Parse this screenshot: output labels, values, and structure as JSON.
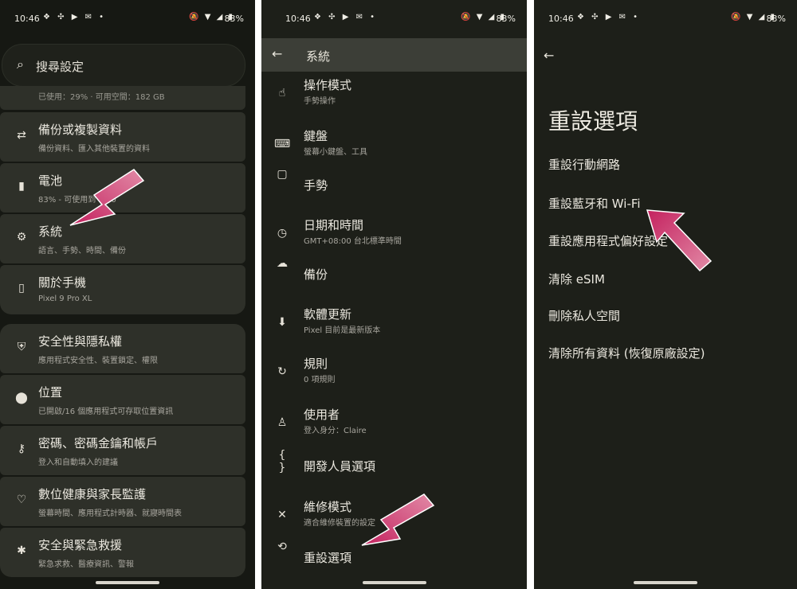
{
  "status": {
    "time": "10:46",
    "notif_icons": "❖ ✣ ▶ ✉ •",
    "right_icons": "🔕 ▼ ◢ ▮",
    "battery": "83%"
  },
  "panel1": {
    "search_placeholder": "搜尋設定",
    "partial_text": "已使用：29% · 可用空間：182 GB",
    "group1": [
      {
        "icon": "⇄",
        "icon_name": "backup-restore-icon",
        "title": "備份或複製資料",
        "subtitle": "備份資料、匯入其他裝置的資料"
      },
      {
        "icon": "▮",
        "icon_name": "battery-icon",
        "title": "電池",
        "subtitle": "83% - 可使用到 9:00"
      },
      {
        "icon": "⚙",
        "icon_name": "gear-icon",
        "title": "系統",
        "subtitle": "語言、手勢、時間、備份"
      },
      {
        "icon": "▯",
        "icon_name": "phone-icon",
        "title": "關於手機",
        "subtitle": "Pixel 9 Pro XL"
      }
    ],
    "group2": [
      {
        "icon": "⛨",
        "icon_name": "shield-icon",
        "title": "安全性與隱私權",
        "subtitle": "應用程式安全性、裝置鎖定、權限"
      },
      {
        "icon": "⬤",
        "icon_name": "location-pin-icon",
        "title": "位置",
        "subtitle": "已開啟/16 個應用程式可存取位置資訊"
      },
      {
        "icon": "⚷",
        "icon_name": "key-icon",
        "title": "密碼、密碼金鑰和帳戶",
        "subtitle": "登入和自動填入的建議"
      },
      {
        "icon": "♡",
        "icon_name": "wellbeing-icon",
        "title": "數位健康與家長監護",
        "subtitle": "螢幕時間、應用程式計時器、就寢時間表"
      },
      {
        "icon": "✱",
        "icon_name": "emergency-icon",
        "title": "安全與緊急救援",
        "subtitle": "緊急求救、醫療資訊、警報"
      }
    ]
  },
  "panel2": {
    "back_icon": "←",
    "title": "系統",
    "items": [
      {
        "icon": "☝",
        "icon_name": "gesture-hand-icon",
        "title": "操作模式",
        "subtitle": "手勢操作"
      },
      {
        "icon": "⌨",
        "icon_name": "keyboard-icon",
        "title": "鍵盤",
        "subtitle": "螢幕小鍵盤、工具"
      },
      {
        "icon": "▢",
        "icon_name": "gestures-icon",
        "title": "手勢",
        "subtitle": ""
      },
      {
        "icon": "◷",
        "icon_name": "clock-icon",
        "title": "日期和時間",
        "subtitle": "GMT+08:00 台北標準時間"
      },
      {
        "icon": "☁",
        "icon_name": "cloud-backup-icon",
        "title": "備份",
        "subtitle": ""
      },
      {
        "icon": "⬇",
        "icon_name": "system-update-icon",
        "title": "軟體更新",
        "subtitle": "Pixel 目前是最新版本"
      },
      {
        "icon": "↻",
        "icon_name": "rules-icon",
        "title": "規則",
        "subtitle": "0 項規則"
      },
      {
        "icon": "♙",
        "icon_name": "user-icon",
        "title": "使用者",
        "subtitle": "登入身分：Claire"
      },
      {
        "icon": "{ }",
        "icon_name": "developer-options-icon",
        "title": "開發人員選項",
        "subtitle": ""
      },
      {
        "icon": "✕",
        "icon_name": "repair-tools-icon",
        "title": "維修模式",
        "subtitle": "適合維修裝置的設定"
      },
      {
        "icon": "⟲",
        "icon_name": "reset-history-icon",
        "title": "重設選項",
        "subtitle": ""
      }
    ]
  },
  "panel3": {
    "back_icon": "←",
    "title": "重設選項",
    "options": [
      "重設行動網路",
      "重設藍牙和 Wi-Fi",
      "重設應用程式偏好設定",
      "清除 eSIM",
      "刪除私人空間",
      "清除所有資料 (恢復原廠設定)"
    ]
  },
  "colors": {
    "accent_arrow": "#d63a78",
    "card_bg": "#2e3029",
    "appbar_bg": "#3c3e37"
  }
}
